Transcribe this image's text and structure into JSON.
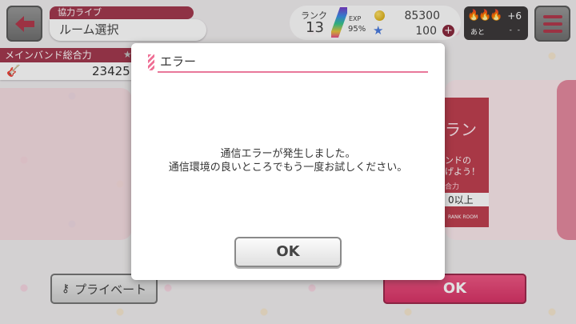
{
  "header": {
    "breadcrumb_top": "協力ライブ",
    "breadcrumb_main": "ルーム選択"
  },
  "status": {
    "rank_label": "ランク",
    "rank_value": "13",
    "exp_label": "EXP",
    "exp_percent": "95%",
    "coins": "85300",
    "stars": "100",
    "stamina_plus": "+6",
    "stamina_next_label": "あと",
    "stamina_next_time": "- -"
  },
  "band": {
    "title": "メインバンド総合力",
    "value": "23425"
  },
  "card": {
    "title": "ラン",
    "desc_line1": "ンドの",
    "desc_line2": "げよう！",
    "sub": "合力",
    "requirement": "0以上",
    "footer": "RANK ROOM"
  },
  "buttons": {
    "private": "プライベート",
    "ok_background": "OK"
  },
  "dialog": {
    "title": "エラー",
    "message_line1": "通信エラーが発生しました。",
    "message_line2": "通信環境の良いところでもう一度お試しください。",
    "ok": "OK"
  },
  "colors": {
    "accent": "#a3394f",
    "pink": "#e8789a",
    "ok_pink": "#e0416f"
  }
}
